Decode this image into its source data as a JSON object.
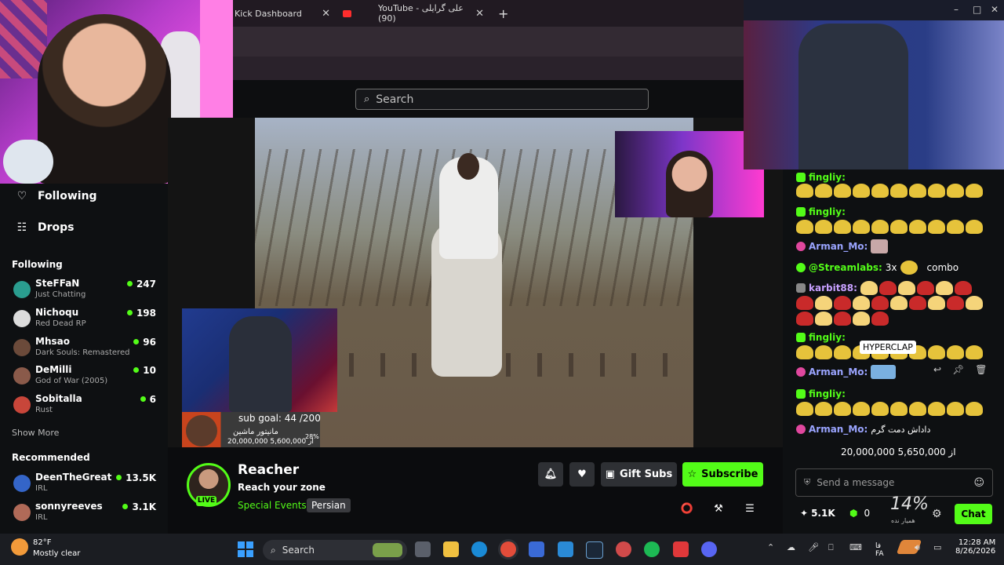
{
  "browser": {
    "tabs": [
      {
        "label": "Kick Dashboard",
        "close": "✕"
      },
      {
        "label": "YouTube - علی گرایلی (90)",
        "close": "✕"
      }
    ],
    "new_tab": "+"
  },
  "search": {
    "placeholder": "Search"
  },
  "sidebar": {
    "nav": [
      {
        "label": "Following",
        "icon": "heart-icon"
      },
      {
        "label": "Drops",
        "icon": "drops-icon"
      }
    ],
    "following_title": "Following",
    "following": [
      {
        "name": "SteFFaN",
        "category": "Just Chatting",
        "viewers": "247",
        "color": "#2a9d8f"
      },
      {
        "name": "Nichoqu",
        "category": "Red Dead RP",
        "viewers": "198",
        "color": "#dcdcdc"
      },
      {
        "name": "Mhsao",
        "category": "Dark Souls: Remastered",
        "viewers": "96",
        "color": "#6b4a3a"
      },
      {
        "name": "DeMilli",
        "category": "God of War (2005)",
        "viewers": "10",
        "color": "#8a5a4a"
      },
      {
        "name": "Sobitalla",
        "category": "Rust",
        "viewers": "6",
        "color": "#c8463a"
      }
    ],
    "show_more": "Show More",
    "recommended_title": "Recommended",
    "recommended": [
      {
        "name": "DeenTheGreat",
        "category": "IRL",
        "viewers": "13.5K",
        "color": "#3465c8"
      },
      {
        "name": "sonnyreeves",
        "category": "IRL",
        "viewers": "3.1K",
        "color": "#b06a58"
      }
    ]
  },
  "player": {
    "sub_goal": "sub goal: 44 /200",
    "overlay_fa": "مانیتور ماشین",
    "overlay_amount": "20,000,000 از 5,600,000",
    "overlay_pct": "28%"
  },
  "stream": {
    "live_badge": "LIVE",
    "streamer": "Reacher",
    "title": "Reach your zone",
    "category": "Special Events",
    "tag": "Persian",
    "gift_subs": "Gift Subs",
    "subscribe": "Subscribe"
  },
  "chat": {
    "messages": [
      {
        "user": "fingliy:",
        "color": "#53fc18",
        "text": ""
      },
      {
        "user": "fingliy:",
        "color": "#53fc18",
        "text": ""
      },
      {
        "user": "Arman_Mo:",
        "color": "#9aa4ff",
        "text": ""
      },
      {
        "user": "@Streamlabs:",
        "color": "#53fc18",
        "text": "3x",
        "extra": "combo"
      },
      {
        "user": "karbit88:",
        "color": "#c7a0ff",
        "text": ""
      },
      {
        "user": "fingliy:",
        "color": "#53fc18",
        "text": ""
      },
      {
        "user": "Arman_Mo:",
        "color": "#9aa4ff",
        "text": ""
      },
      {
        "user": "fingliy:",
        "color": "#53fc18",
        "text": ""
      },
      {
        "user": "Arman_Mo:",
        "color": "#9aa4ff",
        "text": "داداش دمت گرم"
      }
    ],
    "hyperclap": "HYPERCLAP",
    "goal_amounts": "20,000,000 از 5,650,000",
    "input_placeholder": "Send a message",
    "viewers": "5.1K",
    "kicks": "0",
    "goal_pct": "14%",
    "goal_pct_label": "همیار نده",
    "chat_button": "Chat"
  },
  "taskbar": {
    "temp": "82°F",
    "weather": "Mostly clear",
    "search": "Search",
    "lang_top": "فا",
    "lang_bottom": "FA",
    "time": "12:28 AM",
    "date": "8/26/2026"
  }
}
